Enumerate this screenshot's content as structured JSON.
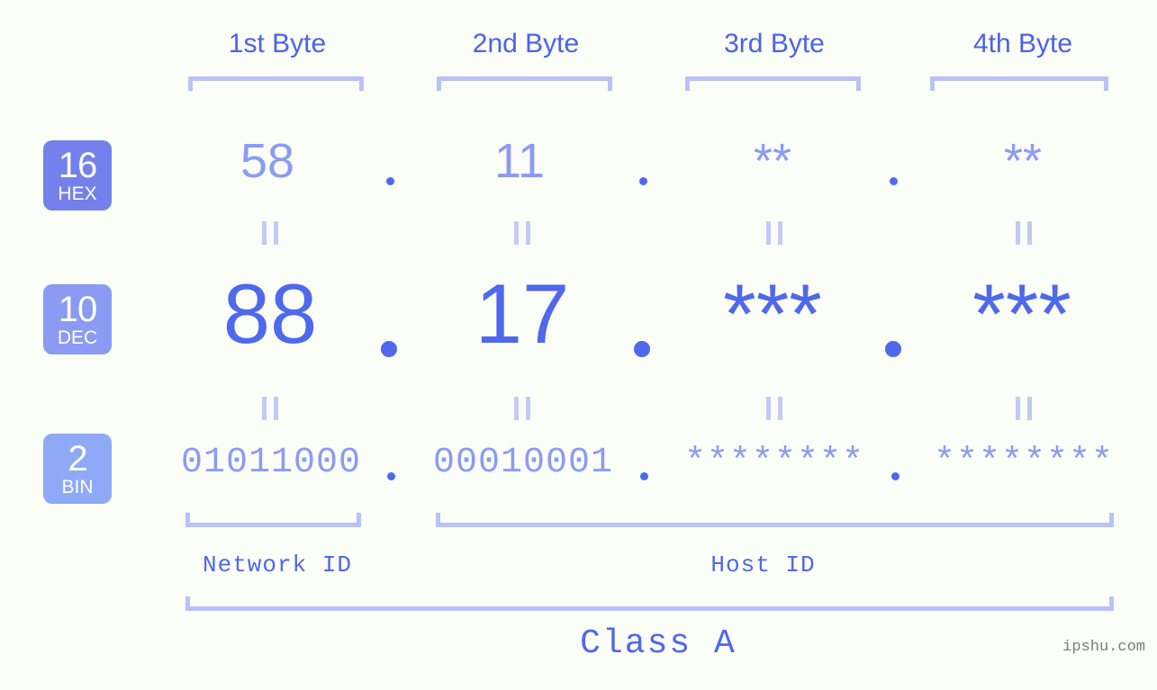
{
  "watermark": "ipshu.com",
  "header": {
    "byte_labels": [
      "1st Byte",
      "2nd Byte",
      "3rd Byte",
      "4th Byte"
    ]
  },
  "bases": [
    {
      "num": "16",
      "name": "HEX",
      "color": "#7481ec"
    },
    {
      "num": "10",
      "name": "DEC",
      "color": "#8b9af2"
    },
    {
      "num": "2",
      "name": "BIN",
      "color": "#8eaaf7"
    }
  ],
  "rows": {
    "hex": {
      "base_label": "16",
      "base_name": "HEX",
      "values": [
        "58",
        "11",
        "**",
        "**"
      ]
    },
    "dec": {
      "base_label": "10",
      "base_name": "DEC",
      "values": [
        "88",
        "17",
        "***",
        "***"
      ]
    },
    "bin": {
      "base_label": "2",
      "base_name": "BIN",
      "values": [
        "01011000",
        "00010001",
        "********",
        "********"
      ]
    }
  },
  "separator": ".",
  "equivalence_symbol": "||",
  "footer": {
    "network_id_label": "Network ID",
    "host_id_label": "Host ID",
    "class_label": "Class A"
  },
  "colors": {
    "background": "#fbfdf7",
    "accent_strong": "#4f68ec",
    "accent_light": "#8c9bf2",
    "bracket": "#b9c2f7",
    "eqmark": "#c2caf8"
  }
}
